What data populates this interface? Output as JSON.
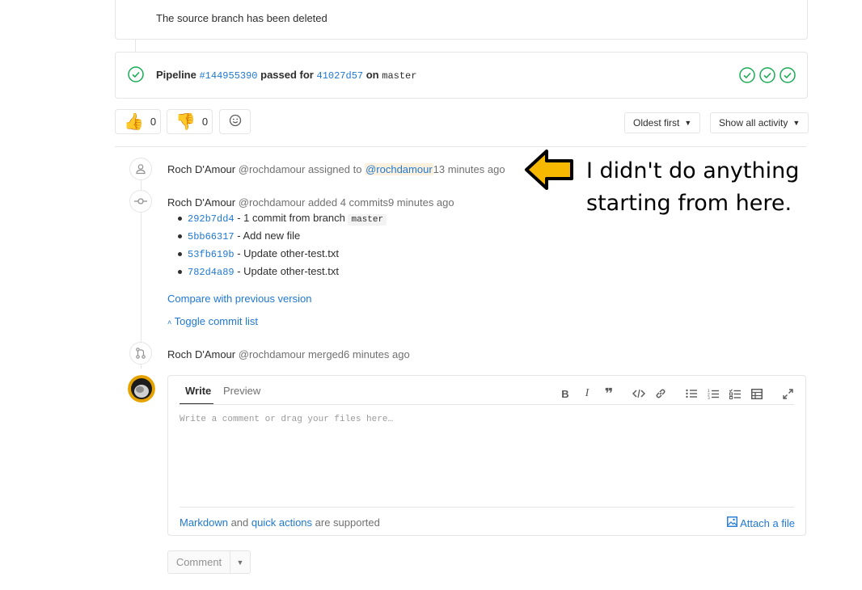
{
  "top_card": {
    "text": "The source branch has been deleted"
  },
  "pipeline": {
    "label": "Pipeline",
    "id": "#144955390",
    "passed_for": "passed for",
    "commit": "41027d57",
    "on": "on",
    "branch": "master",
    "status_color": "#1aaa55"
  },
  "awards": {
    "thumbsup_count": "0",
    "thumbsdown_count": "0"
  },
  "sort": {
    "order_label": "Oldest first",
    "filter_label": "Show all activity"
  },
  "timeline": {
    "assign": {
      "author": "Roch D'Amour",
      "handle": "@rochdamour",
      "action": "assigned to",
      "mention": "@rochdamour",
      "time": "13 minutes ago"
    },
    "commits_note": {
      "author": "Roch D'Amour",
      "handle": "@rochdamour",
      "action": "added 4 commits",
      "time": "9 minutes ago",
      "commits": [
        {
          "sha": "292b7dd4",
          "msg": " - 1 commit from branch ",
          "branch": "master"
        },
        {
          "sha": "5bb66317",
          "msg": " - Add new file"
        },
        {
          "sha": "53fb619b",
          "msg": " - Update other-test.txt"
        },
        {
          "sha": "782d4a89",
          "msg": " - Update other-test.txt"
        }
      ],
      "compare_link": "Compare with previous version",
      "toggle_link": "Toggle commit list"
    },
    "merge": {
      "author": "Roch D'Amour",
      "handle": "@rochdamour",
      "action": "merged",
      "time": "6 minutes ago"
    }
  },
  "annotation": {
    "text": "I didn't do anything\nstarting from here."
  },
  "editor": {
    "tab_write": "Write",
    "tab_preview": "Preview",
    "placeholder": "Write a comment or drag your files here…",
    "footer_markdown": "Markdown",
    "footer_and": " and ",
    "footer_quick": "quick actions",
    "footer_supported": " are supported",
    "attach": "Attach a file",
    "comment_button": "Comment"
  }
}
